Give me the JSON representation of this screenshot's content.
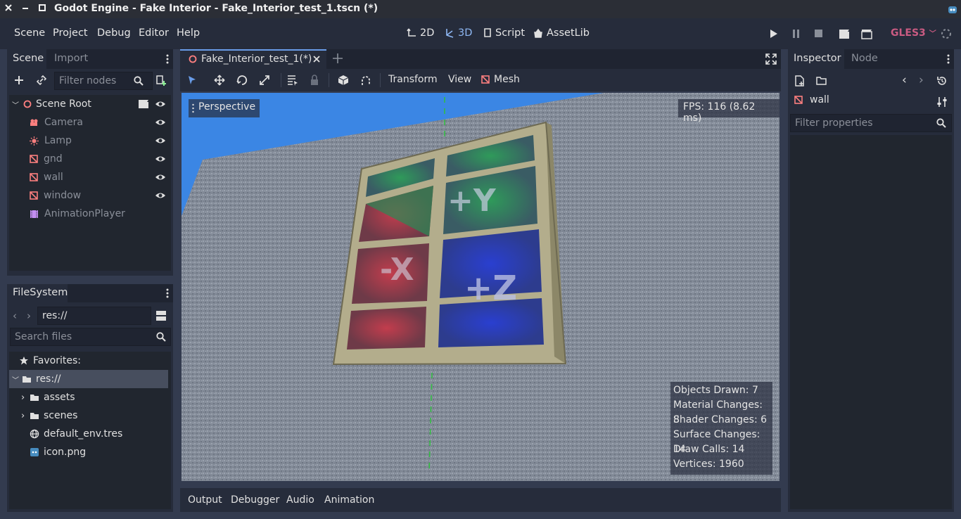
{
  "window": {
    "title": "Godot Engine - Fake Interior - Fake_Interior_test_1.tscn (*)"
  },
  "menubar": {
    "items": [
      "Scene",
      "Project",
      "Debug",
      "Editor",
      "Help"
    ],
    "workspaces": [
      {
        "label": "2D",
        "active": false
      },
      {
        "label": "3D",
        "active": true
      },
      {
        "label": "Script",
        "active": false
      },
      {
        "label": "AssetLib",
        "active": false
      }
    ],
    "renderer": "GLES3"
  },
  "scene_dock": {
    "tabs": [
      "Scene",
      "Import"
    ],
    "filter_placeholder": "Filter nodes",
    "nodes": [
      {
        "name": "Scene Root",
        "icon": "spatial-icon",
        "dim": false
      },
      {
        "name": "Camera",
        "icon": "camera-icon",
        "dim": true
      },
      {
        "name": "Lamp",
        "icon": "light-icon",
        "dim": true
      },
      {
        "name": "gnd",
        "icon": "mesh-icon",
        "dim": true
      },
      {
        "name": "wall",
        "icon": "mesh-icon",
        "dim": true
      },
      {
        "name": "window",
        "icon": "mesh-icon",
        "dim": true
      },
      {
        "name": "AnimationPlayer",
        "icon": "animation-player-icon",
        "dim": true
      }
    ]
  },
  "filesystem_dock": {
    "tab": "FileSystem",
    "path": "res://",
    "search_placeholder": "Search files",
    "favorites_label": "Favorites:",
    "root": "res://",
    "items": [
      {
        "name": "assets",
        "type": "folder"
      },
      {
        "name": "scenes",
        "type": "folder"
      },
      {
        "name": "default_env.tres",
        "type": "environment"
      },
      {
        "name": "icon.png",
        "type": "image"
      }
    ]
  },
  "editor": {
    "scene_tab": "Fake_Interior_test_1(*)",
    "toolbar_menus": [
      "Transform",
      "View",
      "Mesh"
    ],
    "viewport": {
      "perspective_label": "Perspective",
      "fps": "FPS: 116 (8.62 ms)",
      "window_labels": [
        "+Y",
        "-X",
        "+Z"
      ],
      "stats": [
        "Objects Drawn: 7",
        "Material Changes: 8",
        "Shader Changes: 6",
        "Surface Changes: 14",
        "Draw Calls: 14",
        "Vertices: 1960"
      ]
    },
    "bottom_tabs": [
      "Output",
      "Debugger",
      "Audio",
      "Animation"
    ]
  },
  "inspector": {
    "tabs": [
      "Inspector",
      "Node"
    ],
    "object_name": "wall",
    "filter_placeholder": "Filter properties"
  },
  "colors": {
    "accent": "#699ce8",
    "background": "#333b4f",
    "panel": "#262c3b",
    "renderer_label": "#ca5b82"
  }
}
